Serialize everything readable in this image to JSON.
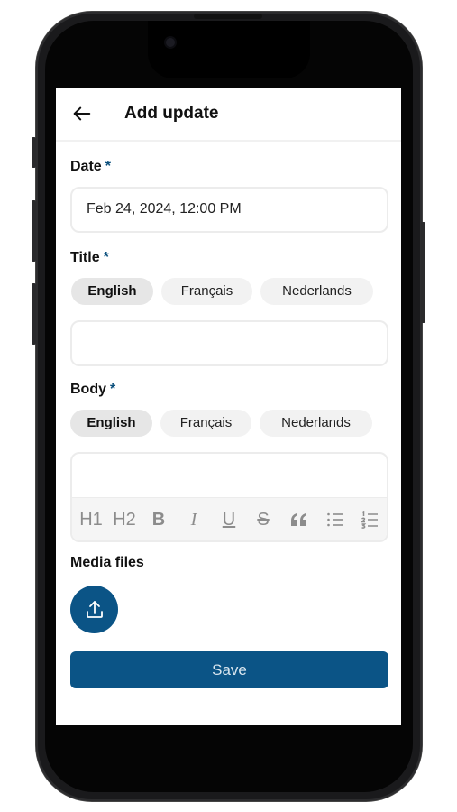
{
  "header": {
    "title": "Add update",
    "back_icon": "arrow-left-icon"
  },
  "date": {
    "label": "Date",
    "required_mark": "*",
    "value": "Feb 24, 2024, 12:00 PM"
  },
  "title_field": {
    "label": "Title",
    "required_mark": "*",
    "languages": [
      "English",
      "Français",
      "Nederlands"
    ],
    "active_language": "English",
    "value": ""
  },
  "body_field": {
    "label": "Body",
    "required_mark": "*",
    "languages": [
      "English",
      "Français",
      "Nederlands"
    ],
    "active_language": "English",
    "value": "",
    "toolbar": {
      "h1": "H1",
      "h2": "H2",
      "bold": "B",
      "italic": "I",
      "underline": "U",
      "strike": "S",
      "icons": [
        "heading1-icon",
        "heading2-icon",
        "bold-icon",
        "italic-icon",
        "underline-icon",
        "strikethrough-icon",
        "quote-icon",
        "bullet-list-icon",
        "numbered-list-icon"
      ]
    }
  },
  "media": {
    "label": "Media files",
    "upload_icon": "upload-icon"
  },
  "save_label": "Save",
  "colors": {
    "accent": "#0b5486",
    "required": "#0b4f7c",
    "chip_bg": "#f2f2f2",
    "toolbar_bg": "#f5f5f5"
  }
}
